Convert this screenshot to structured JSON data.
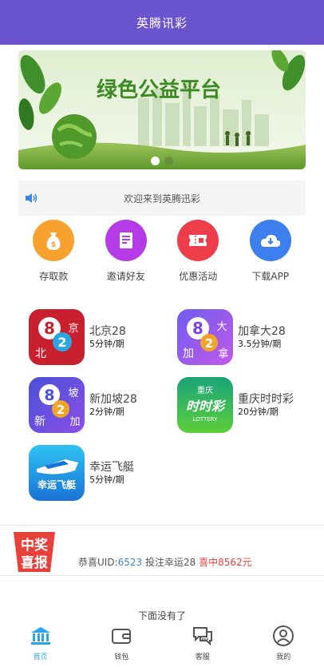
{
  "header": {
    "title": "英腾讯彩"
  },
  "banner": {
    "title": "绿色公益平台",
    "dots": 2,
    "active_dot": 0
  },
  "notice": {
    "icon": "speaker-icon",
    "text": "欢迎来到英腾迅彩"
  },
  "quick_actions": [
    {
      "label": "存取款",
      "icon": "money-bag-icon",
      "color": "#f7a22f"
    },
    {
      "label": "邀请好友",
      "icon": "document-icon",
      "color": "#b43be6"
    },
    {
      "label": "优惠活动",
      "icon": "ticket-icon",
      "color": "#ee3d4a"
    },
    {
      "label": "下载APP",
      "icon": "cloud-download-icon",
      "color": "#3e7ff0"
    }
  ],
  "games": [
    {
      "name": "北京28",
      "period": "5分钟/期",
      "icon": "beijing28-icon",
      "icon_texts": [
        "8",
        "2",
        "京",
        "北"
      ]
    },
    {
      "name": "加拿大28",
      "period": "3.5分钟/期",
      "icon": "canada28-icon",
      "icon_texts": [
        "8",
        "2",
        "大",
        "加",
        "拿"
      ]
    },
    {
      "name": "新加坡28",
      "period": "2分钟/期",
      "icon": "singapore28-icon",
      "icon_texts": [
        "8",
        "2",
        "坡",
        "新",
        "加"
      ]
    },
    {
      "name": "重庆时时彩",
      "period": "20分钟/期",
      "icon": "chongqing-ssc-icon",
      "icon_texts": [
        "重庆",
        "时时彩",
        "LOTTERY"
      ]
    },
    {
      "name": "幸运飞艇",
      "period": "5分钟/期",
      "icon": "lucky-boat-icon",
      "icon_texts": [
        "幸运飞艇"
      ]
    }
  ],
  "ticker": {
    "badge": [
      "中奖",
      "喜报"
    ],
    "prefix": "恭喜UID:",
    "uid": "6523",
    "middle": " 投注幸运28 ",
    "win": "喜中8562元"
  },
  "footer_note": "下面没有了",
  "tabbar": [
    {
      "label": "首页",
      "icon": "bank-icon",
      "active": true
    },
    {
      "label": "钱包",
      "icon": "wallet-icon",
      "active": false
    },
    {
      "label": "客服",
      "icon": "chat-icon",
      "active": false
    },
    {
      "label": "我的",
      "icon": "user-icon",
      "active": false
    }
  ]
}
